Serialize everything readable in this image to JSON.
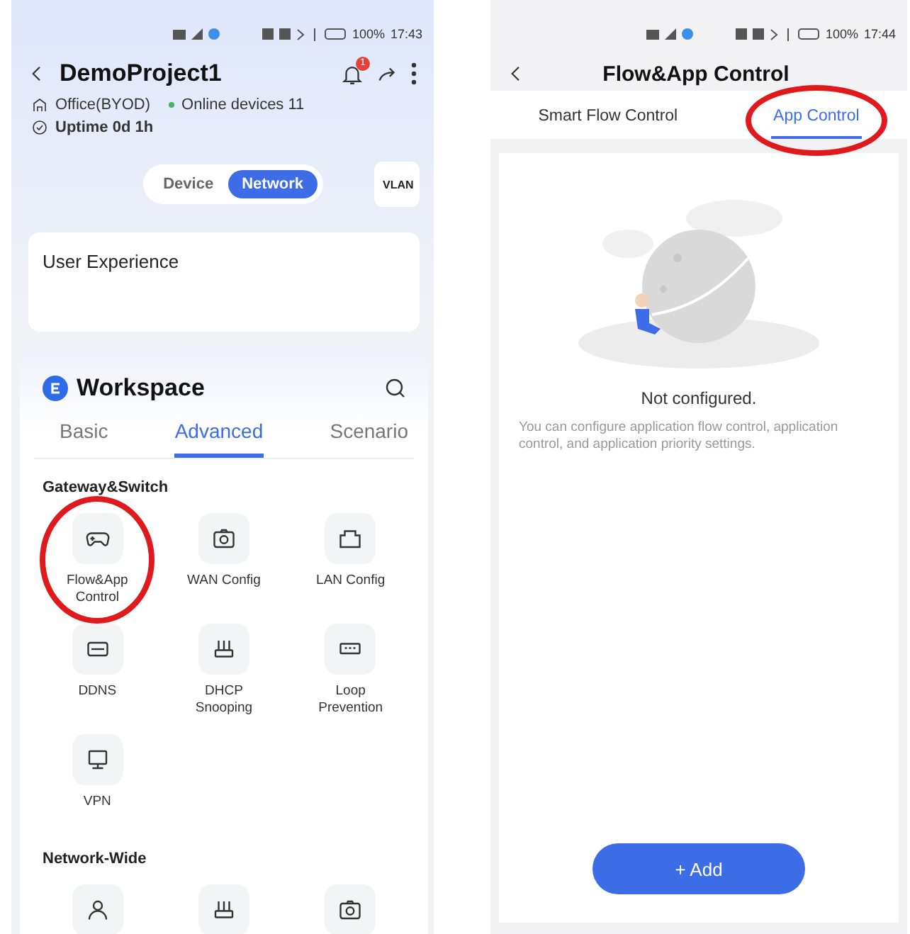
{
  "left_screen": {
    "status_bar": {
      "battery": "100%",
      "time": "17:43"
    },
    "header": {
      "title": "DemoProject1",
      "notification_badge": "1"
    },
    "site": {
      "type": "Office(BYOD)",
      "online": "Online devices 11",
      "uptime": "Uptime 0d 1h"
    },
    "view_toggle": [
      {
        "label": "Device",
        "selected": false
      },
      {
        "label": "Network",
        "selected": true
      }
    ],
    "vlan_button": "VLAN",
    "card": {
      "title": "User Experience"
    },
    "workspace": {
      "title": "Workspace",
      "tabs": [
        {
          "label": "Basic",
          "selected": false
        },
        {
          "label": "Advanced",
          "selected": true
        },
        {
          "label": "Scenario",
          "selected": false
        }
      ],
      "sections": [
        {
          "title": "Gateway&Switch",
          "items": [
            {
              "kind": "gamepad",
              "label": "Flow&App Control",
              "circled": true
            },
            {
              "kind": "camera",
              "label": "WAN Config",
              "circled": false
            },
            {
              "kind": "port",
              "label": "LAN Config",
              "circled": false
            },
            {
              "kind": "ddns",
              "label": "DDNS",
              "circled": false
            },
            {
              "kind": "router",
              "label": "DHCP Snooping",
              "circled": false
            },
            {
              "kind": "switch",
              "label": "Loop Prevention",
              "circled": false
            },
            {
              "kind": "vpn",
              "label": "VPN",
              "circled": false
            }
          ]
        },
        {
          "title": "Network-Wide",
          "items": [
            {
              "kind": "person"
            },
            {
              "kind": "router"
            },
            {
              "kind": "camera"
            }
          ]
        }
      ]
    }
  },
  "right_screen": {
    "status_bar": {
      "battery": "100%",
      "time": "17:44"
    },
    "header": {
      "title": "Flow&App Control"
    },
    "tabs": [
      {
        "label": "Smart Flow Control",
        "selected": false,
        "circled": false
      },
      {
        "label": "App Control",
        "selected": true,
        "circled": true
      }
    ],
    "empty_state": {
      "title": "Not configured.",
      "description": "You can configure application flow control, application control, and application priority settings."
    },
    "add_button": "+ Add"
  }
}
